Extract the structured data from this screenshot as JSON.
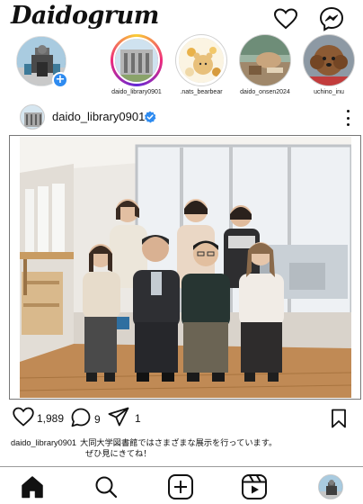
{
  "app": {
    "logo_text": "Daidogrum"
  },
  "header": {
    "icons": [
      "heart-icon",
      "messenger-icon"
    ]
  },
  "stories": [
    {
      "username": "daido_library0901",
      "state": "unseen"
    },
    {
      "username": ".nats_bearbear",
      "state": "seen"
    },
    {
      "username": "daido_onsen2024",
      "state": "seen"
    },
    {
      "username": "uchino_inu",
      "state": "seen"
    }
  ],
  "post": {
    "username": "daido_library0901",
    "verified": true,
    "likes": "1,989",
    "comments": "9",
    "shares": "1",
    "caption_user": "daido_library0901",
    "caption_line1": "大同大学図書館ではさまざまな展示を行っています。",
    "caption_line2": "ぜひ見にきてね！"
  },
  "bottom_nav": [
    "home-icon",
    "search-icon",
    "create-icon",
    "reels-icon",
    "profile-avatar"
  ],
  "colors": {
    "accent_blue": "#2e8bf0",
    "text": "#111111",
    "story_gradient": [
      "#f9ce34",
      "#ee2a7b",
      "#6228d7"
    ]
  }
}
